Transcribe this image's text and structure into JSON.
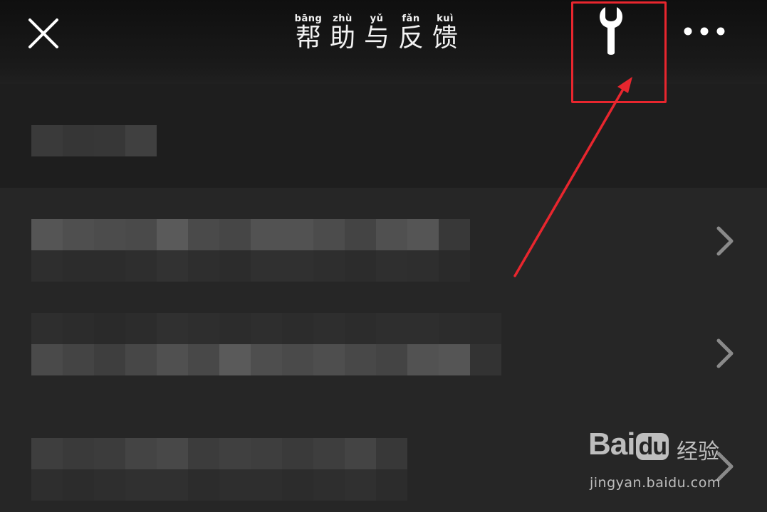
{
  "header": {
    "title_chars": [
      {
        "pinyin": "bāng",
        "hanzi": "帮"
      },
      {
        "pinyin": "zhù",
        "hanzi": "助"
      },
      {
        "pinyin": "yǔ",
        "hanzi": "与"
      },
      {
        "pinyin": "fǎn",
        "hanzi": "反"
      },
      {
        "pinyin": "kuì",
        "hanzi": "馈"
      }
    ],
    "close_icon": "close-icon",
    "tool_icon": "wrench-icon",
    "more_icon": "more-dots-icon"
  },
  "annotation": {
    "color": "#e8262e"
  },
  "list": {
    "chevron_icon": "chevron-right-icon"
  },
  "watermark": {
    "logo_text": "Bai",
    "logo_text_2": "du",
    "cn_text": "经验",
    "url": "jingyan.baidu.com"
  },
  "colors": {
    "background": "#242424",
    "header_bg": "#141414",
    "icon": "#ffffff",
    "chevron": "#8a8a8a"
  }
}
